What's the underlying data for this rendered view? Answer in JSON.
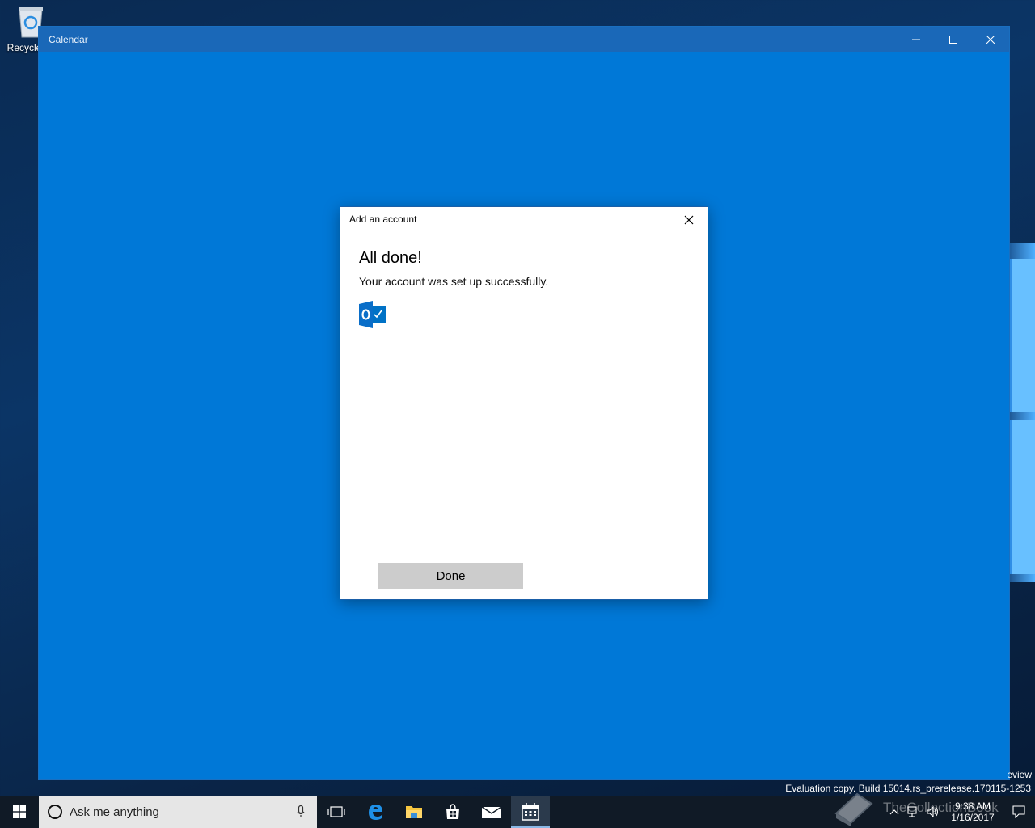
{
  "desktop": {
    "recycle_bin_label": "Recycle"
  },
  "window": {
    "title": "Calendar"
  },
  "dialog": {
    "title": "Add an account",
    "heading": "All done!",
    "message": "Your account was set up successfully.",
    "account_icon": "outlook-icon",
    "done_label": "Done"
  },
  "watermark": {
    "preview_fragment": "eview",
    "evaluation_text": "Evaluation copy. Build 15014.rs_prerelease.170115-1253",
    "site_text": "TheCollectionBook"
  },
  "taskbar": {
    "search_placeholder": "Ask me anything",
    "apps": [
      "task-view-icon",
      "edge-icon",
      "file-explorer-icon",
      "store-icon",
      "mail-icon",
      "calendar-icon"
    ],
    "active_app": "calendar-icon",
    "time": "9:38 AM",
    "date": "1/16/2017"
  },
  "colors": {
    "app_background": "#0078d7",
    "title_bar": "#1a68b8",
    "taskbar": "#101a26",
    "done_button": "#cccccc"
  }
}
